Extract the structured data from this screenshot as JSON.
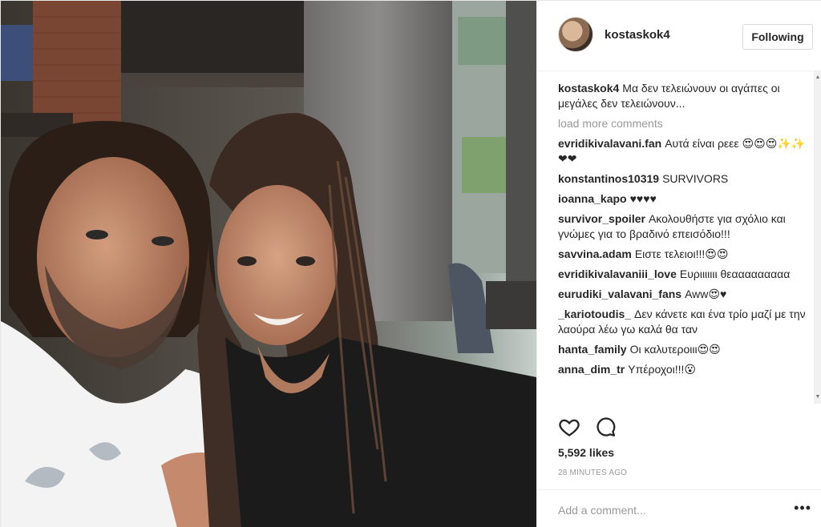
{
  "post": {
    "author": "kostaskok4",
    "follow_label": "Following",
    "caption_user": "kostaskok4",
    "caption_text": "Μα δεν τελειώνουν οι αγάπες οι μεγάλες δεν τελειώνουν...",
    "load_more": "load more comments",
    "comments": [
      {
        "user": "evridikivalavani.fan",
        "text": "Αυτά είναι ρεεε 😍😍😍✨✨❤❤"
      },
      {
        "user": "konstantinos10319",
        "text": "SURVIVORS"
      },
      {
        "user": "ioanna_kapo",
        "text": "♥♥♥♥"
      },
      {
        "user": "survivor_spoiler",
        "text": "Ακολουθήστε για σχόλιο και γνώμες για το βραδινό επεισόδιο!!!"
      },
      {
        "user": "savvina.adam",
        "text": "Ειστε τελειοι!!!😍😍"
      },
      {
        "user": "evridikivalavaniii_love",
        "text": "Ευριιιιιιι θεααααααααα"
      },
      {
        "user": "eurudiki_valavani_fans",
        "text": "Aww😍♥"
      },
      {
        "user": "_kariotoudis_",
        "text": "Δεν κάνετε και ένα τρίο μαζί με την λαούρα λέω γω καλά θα ταν"
      },
      {
        "user": "hanta_family",
        "text": "Οι καλυτεροιιι😍😍"
      },
      {
        "user": "anna_dim_tr",
        "text": "Υπέροχοι!!!😮"
      }
    ],
    "likes": "5,592 likes",
    "time_ago": "28 MINUTES AGO",
    "comment_placeholder": "Add a comment...",
    "more_label": "•••"
  },
  "icons": {
    "like": "heart-icon",
    "comment": "comment-bubble-icon",
    "avatar": "avatar-image",
    "scroll_up": "scroll-up-arrow",
    "scroll_down": "scroll-down-arrow"
  }
}
